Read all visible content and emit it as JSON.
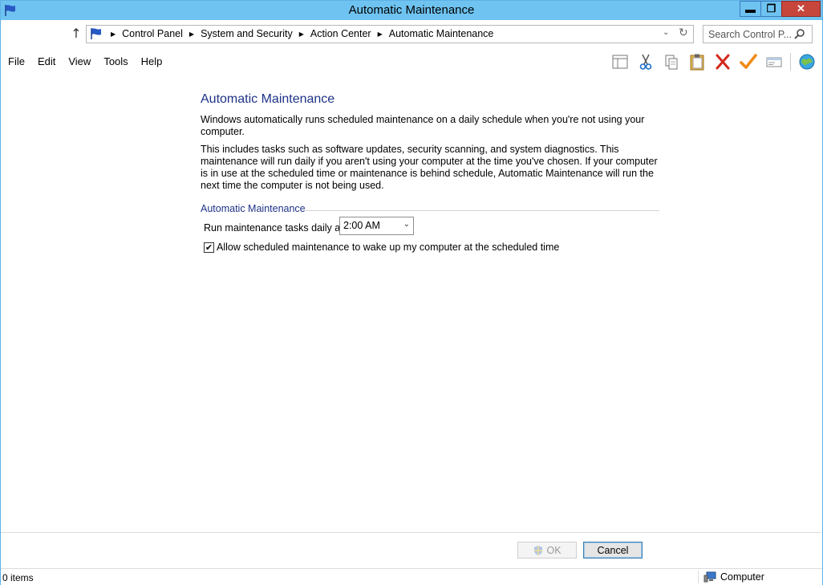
{
  "window": {
    "title": "Automatic Maintenance",
    "minimize_label": "▬",
    "restore_label": "❐",
    "close_label": "✕"
  },
  "address": {
    "crumbs": [
      "Control Panel",
      "System and Security",
      "Action Center",
      "Automatic Maintenance"
    ],
    "search_placeholder": "Search Control P..."
  },
  "menu": {
    "items": [
      "File",
      "Edit",
      "View",
      "Tools",
      "Help"
    ]
  },
  "toolbar": {
    "icons": [
      "layout-icon",
      "cut-icon",
      "copy-icon",
      "paste-icon",
      "delete-icon",
      "checkmark-icon",
      "properties-icon",
      "globe-icon"
    ]
  },
  "content": {
    "title": "Automatic Maintenance",
    "para1": "Windows automatically runs scheduled maintenance on a daily schedule when you're not using your computer.",
    "para2": "This includes tasks such as software updates, security scanning, and system diagnostics. This maintenance will run daily if you aren't using your computer at the time you've chosen. If your computer is in use at the scheduled time or maintenance is behind schedule, Automatic Maintenance will run the next time the computer is not being used.",
    "section_title": "Automatic Maintenance",
    "run_label": "Run maintenance tasks daily at",
    "time_value": "2:00 AM",
    "wake_label": "Allow scheduled maintenance to wake up my computer at the scheduled time",
    "wake_checked": true
  },
  "buttons": {
    "ok": "OK",
    "cancel": "Cancel"
  },
  "status": {
    "items": "0 items",
    "location": "Computer"
  },
  "colors": {
    "titlebar": "#6ec3f0",
    "close_button": "#c7463b",
    "heading_blue": "#1e3287"
  }
}
